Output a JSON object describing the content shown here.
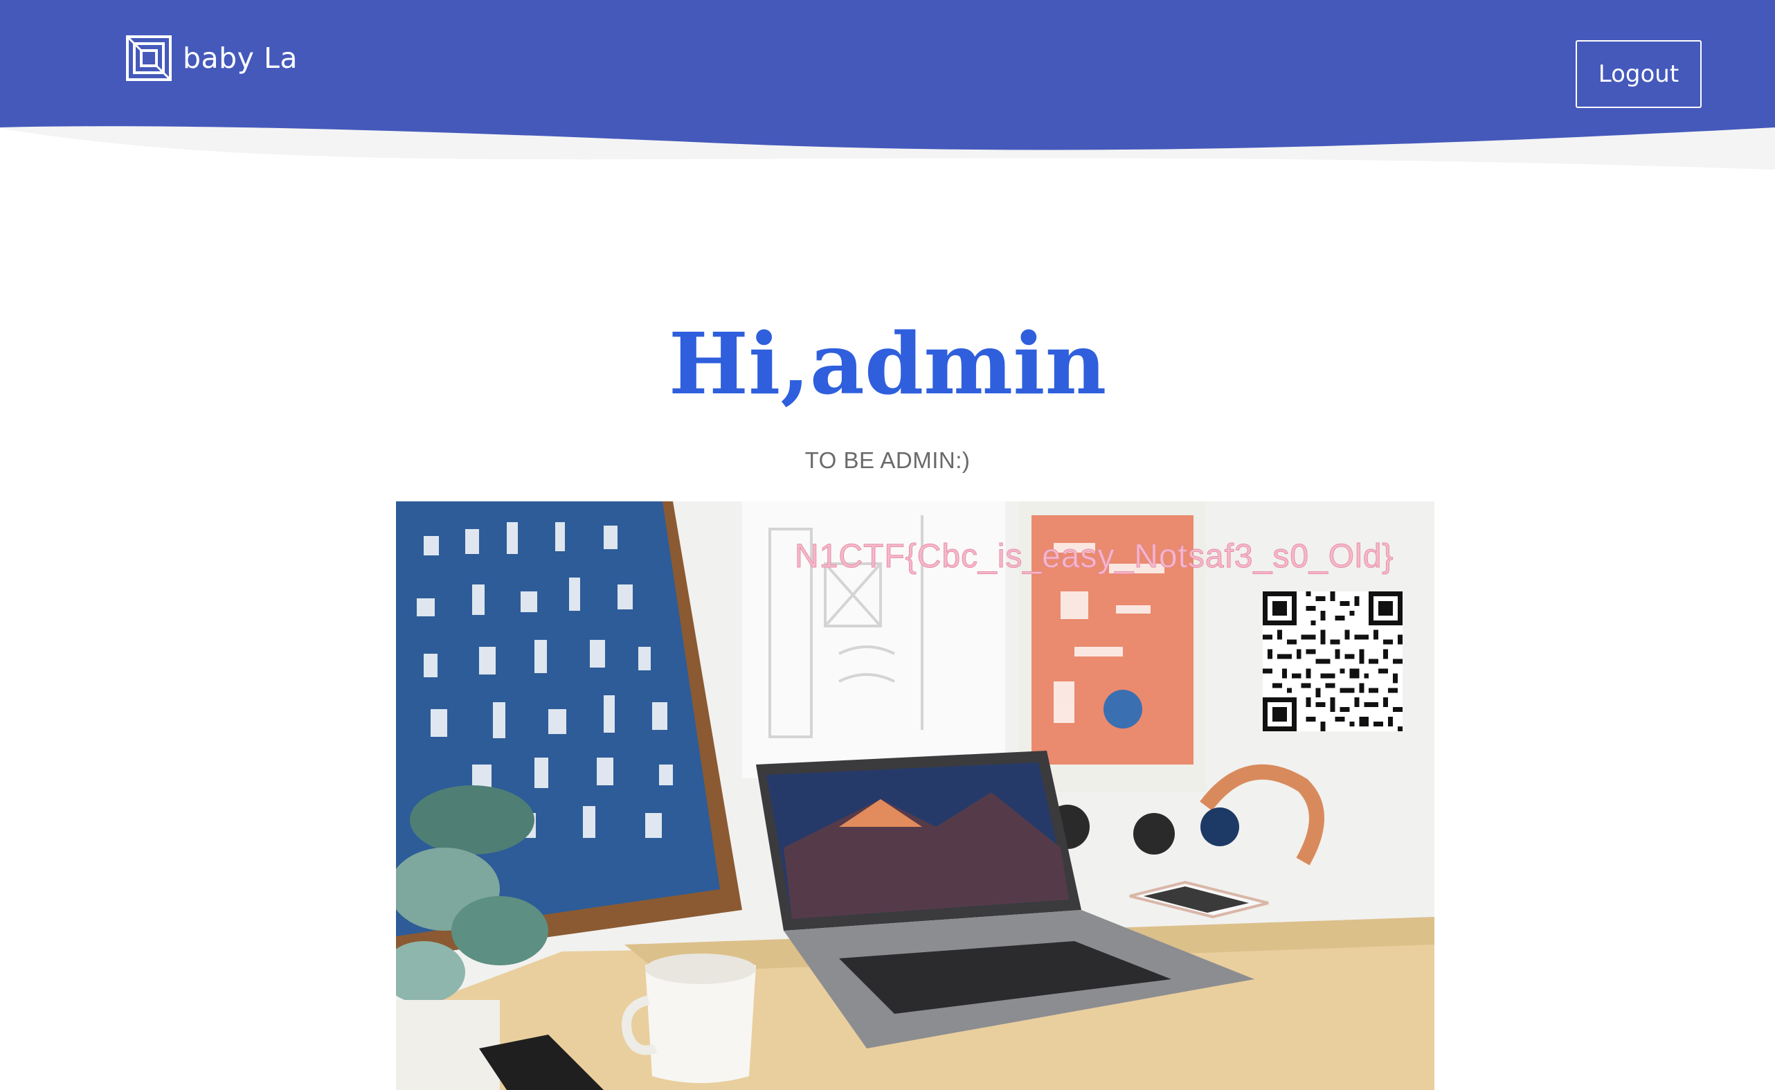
{
  "header": {
    "brand_name": "baby La",
    "logo_icon": "layered-square-logo-icon",
    "logout_label": "Logout",
    "background_color": "#4559bb"
  },
  "main": {
    "title": "Hi,admin",
    "title_color": "#2f5fdc",
    "subtitle": "TO BE ADMIN:)"
  },
  "hero": {
    "image": "desk-workspace-photo",
    "flag_text": "N1CTF{Cbc_is_easy_Notsaf3_s0_Old}",
    "qr_icon": "qr-code-icon"
  }
}
